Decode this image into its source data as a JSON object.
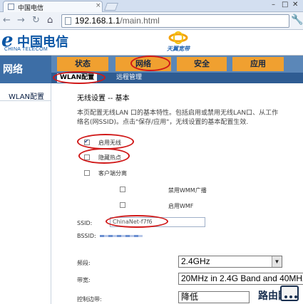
{
  "browser": {
    "tab_title": "中国电信",
    "tab_close": "×",
    "window_controls": [
      "–",
      "□",
      "✕"
    ],
    "back_icon": "back-arrow-icon",
    "forward_icon": "forward-arrow-icon",
    "reload_icon": "reload-icon",
    "home_icon": "home-icon",
    "url_host": "192.168.1.1",
    "url_path": "/main.html",
    "menu_icon": "wrench-icon"
  },
  "header": {
    "logo_cn": "中国电信",
    "logo_en": "CHINA TELECOM",
    "brand_text": "天翼宽带"
  },
  "nav": {
    "section_title": "网络",
    "tabs": [
      {
        "label": "状态"
      },
      {
        "label": "网络"
      },
      {
        "label": "安全"
      },
      {
        "label": "应用"
      }
    ],
    "subtabs": [
      {
        "label": "WLAN配置"
      },
      {
        "label": "远程管理"
      }
    ]
  },
  "sidebar": {
    "items": [
      {
        "label": "WLAN配置"
      }
    ]
  },
  "content": {
    "title": "无线设置 -- 基本",
    "desc_line1": "本页配置无线LAN 口的基本特性。包括启用或禁用无线LAN口、从工作",
    "desc_line2": "络名(网SSID)。点击\"保存/应用\"，无线设置的基本配置生效.",
    "checkboxes": {
      "enable_wireless": {
        "label": "启用无线",
        "checked": true
      },
      "hide_ap": {
        "label": "隐藏热点",
        "checked": false
      },
      "client_isolation": {
        "label": "客户端分离",
        "checked": false
      },
      "disable_wmm": {
        "label": "禁用WMM广播",
        "checked": false
      },
      "enable_wmf": {
        "label": "启用WMF",
        "checked": false
      }
    },
    "ssid_label": "SSID:",
    "ssid_value": "ChinaNet-f7f6",
    "bssid_label": "BSSID:",
    "band_label": "频段:",
    "band_value": "2.4GHz",
    "bandwidth_label": "带宽:",
    "bandwidth_value": "20MHz in 2.4G Band and 40MHz",
    "sideband_label": "控制边带:",
    "sideband_value": "降低"
  },
  "watermark": {
    "text": "路由网"
  },
  "colors": {
    "nav_bar": "#5b87b8",
    "nav_tab": "#f0a030",
    "subnav": "#2f5c92",
    "brand_blue": "#0b56a5",
    "annotation_red": "#d01818"
  }
}
